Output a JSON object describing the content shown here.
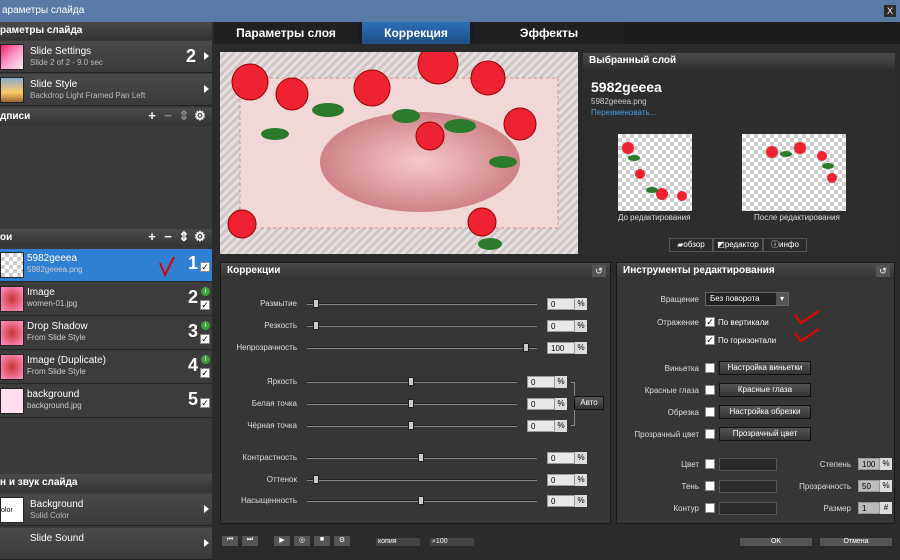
{
  "window": {
    "title": "араметры слайда",
    "close_label": "X"
  },
  "left": {
    "section_slide": "раметры слайда",
    "slide_settings": {
      "title": "Slide Settings",
      "sub": "Slide 2 of 2 - 9.0 sec",
      "num": "2"
    },
    "slide_style": {
      "title": "Slide Style",
      "sub": "Backdrop Light Framed Pan Left"
    },
    "captions_header": "дписи",
    "layers_header": "ои",
    "layers": [
      {
        "title": "5982geeea",
        "sub": "5982geeea.png",
        "num": "1"
      },
      {
        "title": "Image",
        "sub": "women-01.jpg",
        "num": "2"
      },
      {
        "title": "Drop Shadow",
        "sub": "From Slide Style",
        "num": "3"
      },
      {
        "title": "Image (Duplicate)",
        "sub": "From Slide Style",
        "num": "4"
      },
      {
        "title": "background",
        "sub": "background.jpg",
        "num": "5"
      }
    ],
    "sound_header": "н и звук слайда",
    "background": {
      "title": "Background",
      "sub": "Solid Color",
      "thumb": "olor"
    },
    "sound": {
      "title": "Slide Sound"
    }
  },
  "tabs": [
    "Параметры слоя",
    "Коррекция",
    "Эффекты"
  ],
  "selected_layer": {
    "header": "Выбранный слой",
    "name": "5982geeea",
    "file": "5982geeea.png",
    "rename": "Переименовать...",
    "before_label": "До редактирования",
    "after_label": "После редактирования",
    "btn_browse": "обзор",
    "btn_editor": "редактор",
    "btn_info": "инфо"
  },
  "corrections": {
    "header": "Коррекции",
    "rows": [
      {
        "label": "Размытие",
        "value": "0"
      },
      {
        "label": "Резкость",
        "value": "0"
      },
      {
        "label": "Непрозрачность",
        "value": "100"
      },
      {
        "label": "Яркость",
        "value": "0"
      },
      {
        "label": "Белая точка",
        "value": "0"
      },
      {
        "label": "Чёрная точка",
        "value": "0"
      },
      {
        "label": "Контрастность",
        "value": "0"
      },
      {
        "label": "Оттенок",
        "value": "0"
      },
      {
        "label": "Насыщенность",
        "value": "0"
      }
    ],
    "pct": "%",
    "auto": "Авто"
  },
  "tools": {
    "header": "Инструменты редактирования",
    "rotation_label": "Вращение",
    "rotation_value": "Без поворота",
    "reflection_label": "Отражение",
    "vertical": "По вертикали",
    "horizontal": "По горизонтали",
    "vignette_label": "Виньетка",
    "vignette_btn": "Настройка виньетки",
    "redeye_label": "Красные глаза",
    "redeye_btn": "Красные глаза",
    "crop_label": "Обрезка",
    "crop_btn": "Настройка обрезки",
    "transp_label": "Прозрачный цвет",
    "transp_btn": "Прозрачный цвет",
    "color_label": "Цвет",
    "shadow_label": "Тень",
    "outline_label": "Контур",
    "degree_label": "Степень",
    "degree_value": "100",
    "opacity_label": "Прозрачность",
    "opacity_value": "50",
    "size_label": "Размер",
    "size_value": "1",
    "pct": "%",
    "hash": "#"
  },
  "bottom": {
    "copy": "копия",
    "zoom": "100",
    "ok": "OK",
    "cancel": "Отмена"
  }
}
